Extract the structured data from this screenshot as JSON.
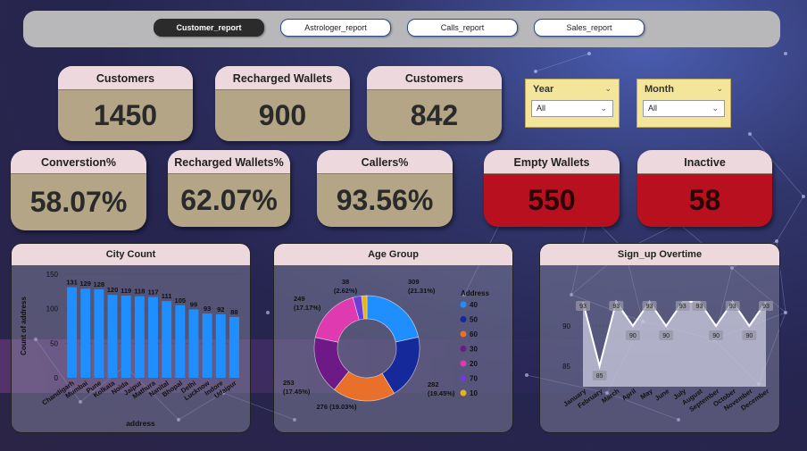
{
  "nav": {
    "tabs": [
      {
        "label": "Customer_report",
        "active": true
      },
      {
        "label": "Astrologer_report",
        "active": false
      },
      {
        "label": "Calls_report",
        "active": false
      },
      {
        "label": "Sales_report",
        "active": false
      }
    ]
  },
  "kpis": {
    "customers_1": {
      "label": "Customers",
      "value": "1450"
    },
    "recharged_wallets": {
      "label": "Recharged Wallets",
      "value": "900"
    },
    "customers_2": {
      "label": "Customers",
      "value": "842"
    },
    "conversion": {
      "label": "Converstion%",
      "value": "58.07%"
    },
    "recharged_wallets_pct": {
      "label": "Recharged Wallets%",
      "value": "62.07%"
    },
    "callers_pct": {
      "label": "Callers%",
      "value": "93.56%"
    },
    "empty_wallets": {
      "label": "Empty Wallets",
      "value": "550"
    },
    "inactive": {
      "label": "Inactive",
      "value": "58"
    }
  },
  "filters": {
    "year": {
      "label": "Year",
      "selected": "All"
    },
    "month": {
      "label": "Month",
      "selected": "All"
    }
  },
  "colors": {
    "card_tan": "#b3a586",
    "card_red": "#b8101e",
    "card_header": "#ecd8dd",
    "bar_blue": "#1f8fff",
    "slicer_yellow": "#f3e69a"
  },
  "chart_data": [
    {
      "type": "bar",
      "title": "City Count",
      "xlabel": "address",
      "ylabel": "Count of address",
      "categories": [
        "Chandigarh",
        "Mumbai",
        "Pune",
        "Kolkata",
        "Noida",
        "Jaipur",
        "Mathura",
        "Nanital",
        "Bhopal",
        "Delhi",
        "Lucknow",
        "Indore",
        "Udaipur"
      ],
      "values": [
        131,
        129,
        128,
        120,
        119,
        118,
        117,
        111,
        105,
        99,
        93,
        92,
        88
      ],
      "ylim": [
        0,
        150
      ],
      "yticks": [
        0,
        50,
        100,
        150
      ]
    },
    {
      "type": "pie",
      "title": "Age Group",
      "legend_title": "Address",
      "legend_position": "right",
      "slices": [
        {
          "name": "40",
          "value": 309,
          "label": "309 (21.31%)",
          "color": "#1f8fff"
        },
        {
          "name": "50",
          "value": 282,
          "label": "282 (19.45%)",
          "color": "#16299b"
        },
        {
          "name": "60",
          "value": 276,
          "label": "276 (19.03%)",
          "color": "#e8702b"
        },
        {
          "name": "30",
          "value": 253,
          "label": "253 (17.45%)",
          "color": "#6e1a86"
        },
        {
          "name": "20",
          "value": 249,
          "label": "249 (17.17%)",
          "color": "#e03ab0"
        },
        {
          "name": "70",
          "value": 38,
          "label": "38 (2.62%)",
          "color": "#6b3fd6"
        },
        {
          "name": "10",
          "value": 23,
          "label": "",
          "color": "#e6b416"
        }
      ]
    },
    {
      "type": "area",
      "title": "Sign_up Overtime",
      "categories": [
        "January",
        "February",
        "March",
        "April",
        "May",
        "June",
        "July",
        "August",
        "September",
        "October",
        "November",
        "December"
      ],
      "values": [
        93,
        85,
        93,
        90,
        93,
        90,
        93,
        93,
        90,
        93,
        90,
        93
      ],
      "ylim": [
        85,
        93
      ],
      "yticks": [
        85,
        90
      ]
    }
  ]
}
